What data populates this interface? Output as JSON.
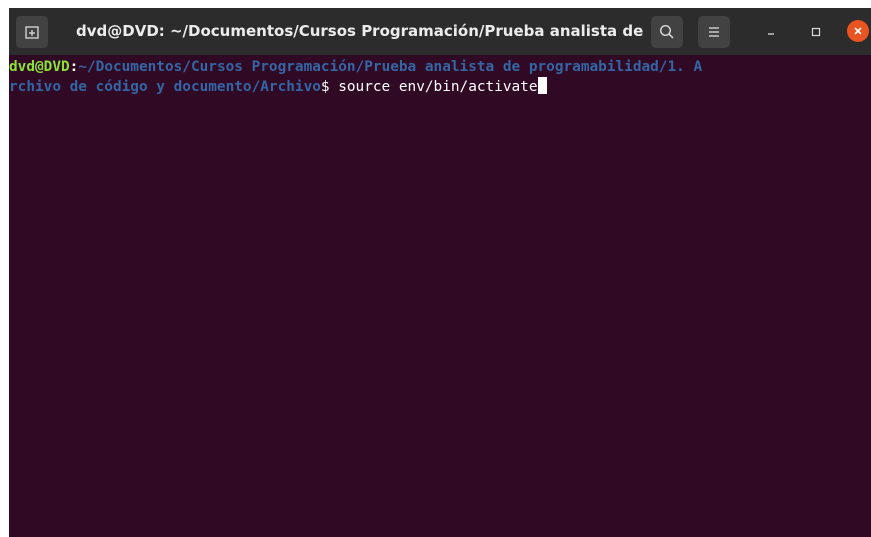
{
  "window": {
    "title": "dvd@DVD: ~/Documentos/Cursos Programación/Prueba analista de …",
    "icons": {
      "new_tab": "new-tab-icon",
      "search": "search-icon",
      "menu": "hamburger-menu-icon",
      "minimize": "minimize-icon",
      "maximize": "maximize-icon",
      "close": "close-icon"
    }
  },
  "terminal": {
    "line1": {
      "user": "dvd@DVD",
      "colon": ":",
      "path": "~/Documentos/Cursos Programación/Prueba analista de programabilidad/1. A"
    },
    "line2": {
      "path": "rchivo de código y documento/Archivo",
      "prompt": "$ ",
      "command": "source env/bin/activate"
    }
  },
  "colors": {
    "terminal_bg": "#300a24",
    "titlebar_bg": "#2c2c2c",
    "user": "#8ae234",
    "path": "#3465a4",
    "close": "#e95420"
  }
}
